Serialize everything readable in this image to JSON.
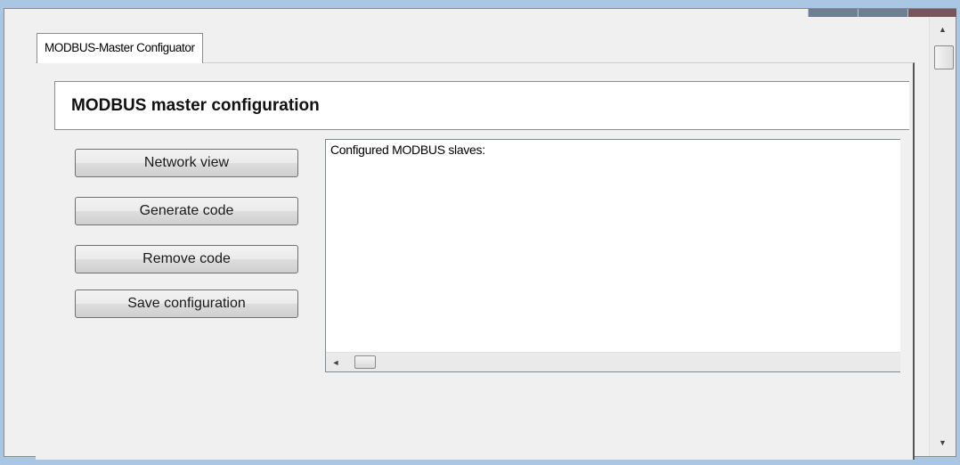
{
  "tab": {
    "label": "MODBUS-Master Configuator"
  },
  "header": {
    "title": "MODBUS master configuration"
  },
  "buttons": {
    "network_view": "Network view",
    "generate_code": "Generate code",
    "remove_code": "Remove code",
    "save_configuration": "Save configuration"
  },
  "slaves_list": {
    "label": "Configured MODBUS slaves:"
  },
  "scroll_icons": {
    "left": "◄",
    "up": "▲",
    "down": "▼"
  },
  "colors": {
    "background": "#a9c7e3",
    "panel": "#f0f0f0",
    "titlebar": "#6e7f93"
  }
}
